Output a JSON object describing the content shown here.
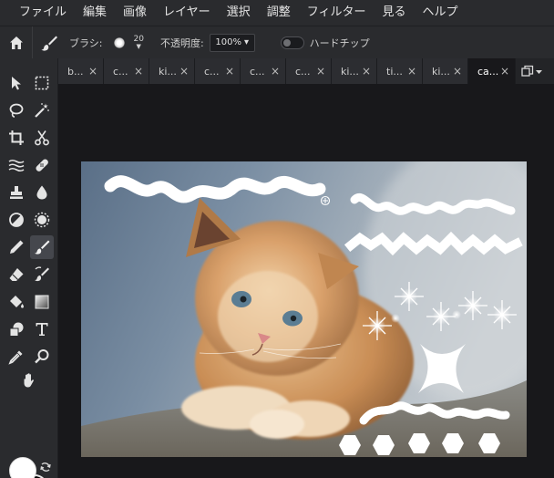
{
  "menubar": {
    "items": [
      "ファイル",
      "編集",
      "画像",
      "レイヤー",
      "選択",
      "調整",
      "フィルター",
      "見る",
      "ヘルプ"
    ]
  },
  "options": {
    "brush_label": "ブラシ:",
    "brush_size": "20",
    "opacity_label": "不透明度:",
    "opacity_value": "100%",
    "opacity_arrow": "▾",
    "hard_tip_label": "ハードチップ",
    "hard_tip_enabled": false
  },
  "tabs": [
    {
      "label": "b...",
      "close": "×"
    },
    {
      "label": "c...",
      "close": "×"
    },
    {
      "label": "ki...",
      "close": "×"
    },
    {
      "label": "c...",
      "close": "×"
    },
    {
      "label": "c...",
      "close": "×"
    },
    {
      "label": "c...",
      "close": "×"
    },
    {
      "label": "ki...",
      "close": "×"
    },
    {
      "label": "ti...",
      "close": "×"
    },
    {
      "label": "ki...",
      "close": "×"
    },
    {
      "label": "ca...",
      "close": "×"
    }
  ],
  "active_tab": 9,
  "colors": {
    "foreground": "#ffffff",
    "background": "#000000",
    "accent_active_tool": "#45474d"
  },
  "tools": [
    "move-tool-icon",
    "marquee-tool-icon",
    "lasso-tool-icon",
    "magic-wand-icon",
    "crop-tool-icon",
    "cut-tool-icon",
    "liquify-tool-icon",
    "healing-bandage-icon",
    "clone-stamp-icon",
    "blur-drop-icon",
    "dodge-burn-icon",
    "sponge-gear-icon",
    "pencil-tool-icon",
    "brush-tool-icon",
    "eraser-tool-icon",
    "replace-color-brush-icon",
    "paint-bucket-icon",
    "gradient-tool-icon",
    "shape-tool-icon",
    "text-tool-icon",
    "eyedropper-tool-icon",
    "zoom-tool-icon",
    "hand-tool-icon"
  ],
  "active_tool": "brush-tool-icon"
}
